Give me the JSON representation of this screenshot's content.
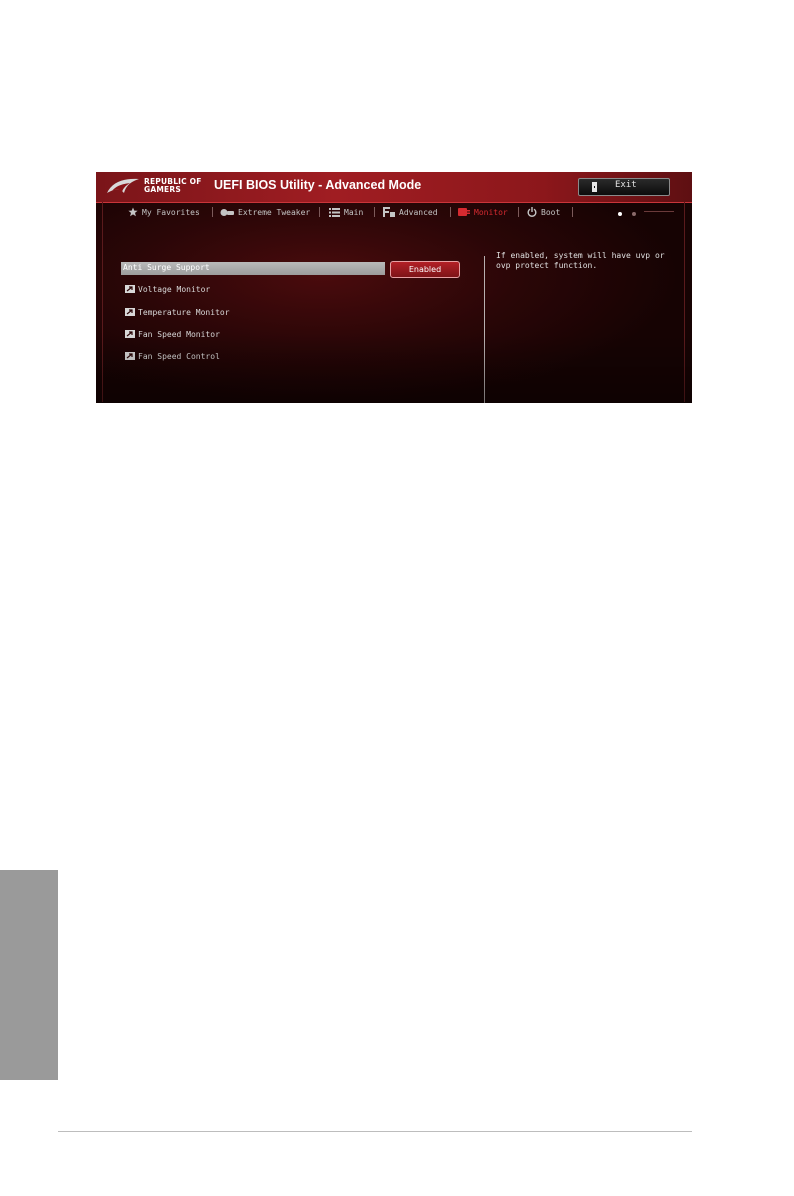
{
  "bios": {
    "brand": {
      "line1": "REPUBLIC OF",
      "line2": "GAMERS"
    },
    "title": "UEFI BIOS Utility - Advanced Mode",
    "exit_label": "Exit",
    "tabs": [
      {
        "label": "My Favorites",
        "icon": "star-icon",
        "active": false
      },
      {
        "label": "Extreme Tweaker",
        "icon": "tweaker-icon",
        "active": false
      },
      {
        "label": "Main",
        "icon": "list-icon",
        "active": false
      },
      {
        "label": "Advanced",
        "icon": "advanced-icon",
        "active": false
      },
      {
        "label": "Monitor",
        "icon": "monitor-icon",
        "active": true
      },
      {
        "label": "Boot",
        "icon": "power-icon",
        "active": false
      }
    ],
    "items": {
      "selected": {
        "label": "Anti Surge Support",
        "value": "Enabled"
      },
      "submenus": [
        "Voltage Monitor",
        "Temperature Monitor",
        "Fan Speed Monitor",
        "Fan Speed Control"
      ]
    },
    "help_text": "If enabled, system will have uvp or ovp protect function.",
    "colors": {
      "accent": "#d62a30",
      "title_bar": "#a01d22",
      "background": "#2a0607"
    }
  }
}
